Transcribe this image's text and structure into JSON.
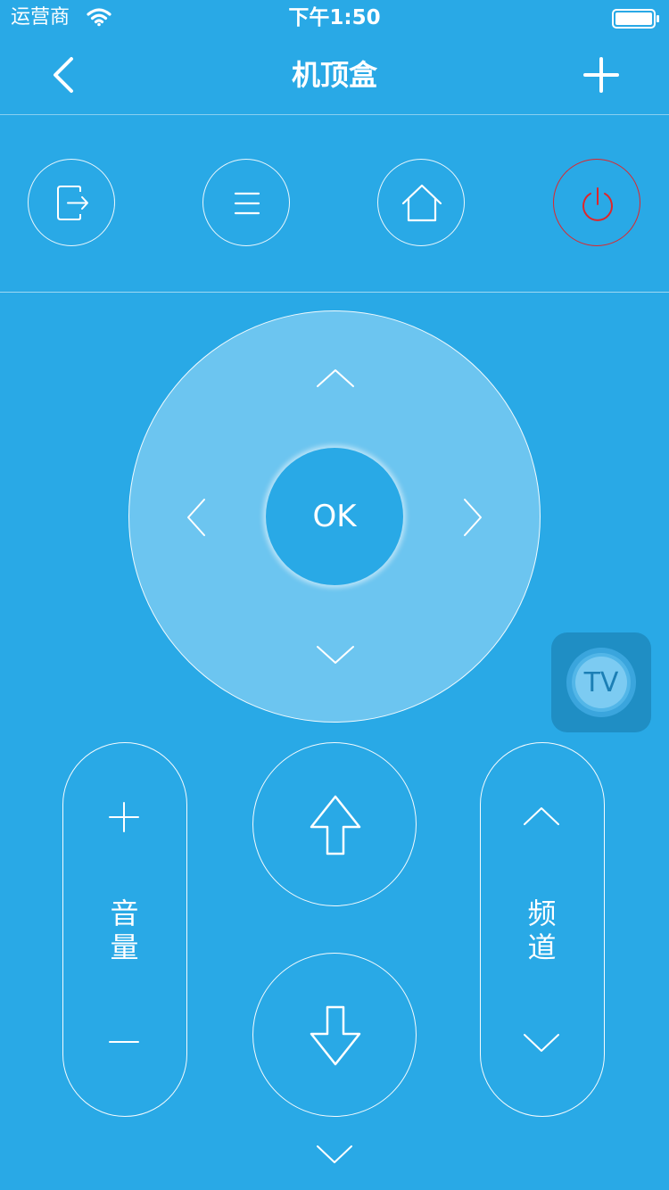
{
  "status_bar": {
    "carrier": "运营商",
    "time": "下午1:50",
    "wifi_icon": "wifi-icon",
    "battery_icon": "battery-icon"
  },
  "nav": {
    "title": "机顶盒",
    "back_icon": "chevron-left-icon",
    "add_icon": "plus-icon"
  },
  "function_row": [
    {
      "name": "exit",
      "icon": "exit-icon"
    },
    {
      "name": "menu",
      "icon": "menu-icon"
    },
    {
      "name": "home",
      "icon": "home-icon"
    },
    {
      "name": "power",
      "icon": "power-icon",
      "color": "#e0252a"
    }
  ],
  "dpad": {
    "ok_label": "OK",
    "up_icon": "chevron-up-icon",
    "down_icon": "chevron-down-icon",
    "left_icon": "chevron-left-icon",
    "right_icon": "chevron-right-icon"
  },
  "tv_badge": {
    "label": "TV"
  },
  "volume": {
    "label_1": "音",
    "label_2": "量",
    "plus_icon": "plus-icon",
    "minus_icon": "minus-icon"
  },
  "channel": {
    "label_1": "频",
    "label_2": "道",
    "up_icon": "chevron-up-icon",
    "down_icon": "chevron-down-icon"
  },
  "center_buttons": {
    "up_icon": "arrow-up-icon",
    "down_icon": "arrow-down-icon"
  },
  "more_icon": "chevron-down-icon",
  "colors": {
    "background": "#29a9e6",
    "dpad": "#6cc5f0",
    "power": "#e0252a",
    "tv_badge": "#1f8ec4"
  }
}
